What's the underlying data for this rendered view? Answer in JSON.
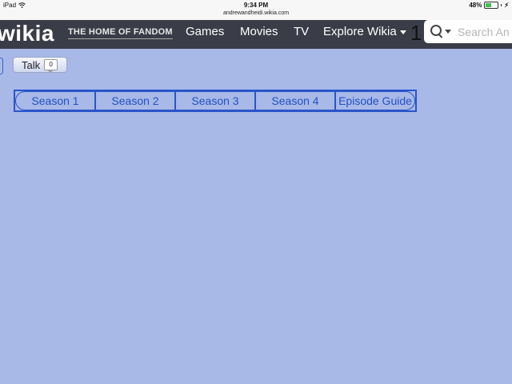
{
  "status_bar": {
    "device": "iPad",
    "time": "9:34 PM",
    "url": "andrewandheidi.wikia.com",
    "battery_percent": "48%",
    "battery_level": 0.48
  },
  "header": {
    "logo": "wikia",
    "tagline": "THE HOME OF FANDOM",
    "nav": {
      "games": "Games",
      "movies": "Movies",
      "tv": "TV",
      "explore": "Explore Wikia"
    },
    "cut_text": "1",
    "search_placeholder": "Search An"
  },
  "talk": {
    "label": "Talk",
    "count": "0"
  },
  "tabs": [
    "Season 1",
    "Season 2",
    "Season 3",
    "Season 4",
    "Episode Guide"
  ],
  "colors": {
    "page_bg": "#a8b9e8",
    "header_bg": "#3a3d48",
    "tab_border": "#2a55c9",
    "tab_text": "#2350c4"
  },
  "icons": {
    "wifi": "wifi-icon",
    "battery": "battery-icon",
    "charging": "charging-bolt-icon",
    "search": "search-icon",
    "dropdown": "chevron-down-icon",
    "talk_bubble": "speech-bubble-icon"
  }
}
